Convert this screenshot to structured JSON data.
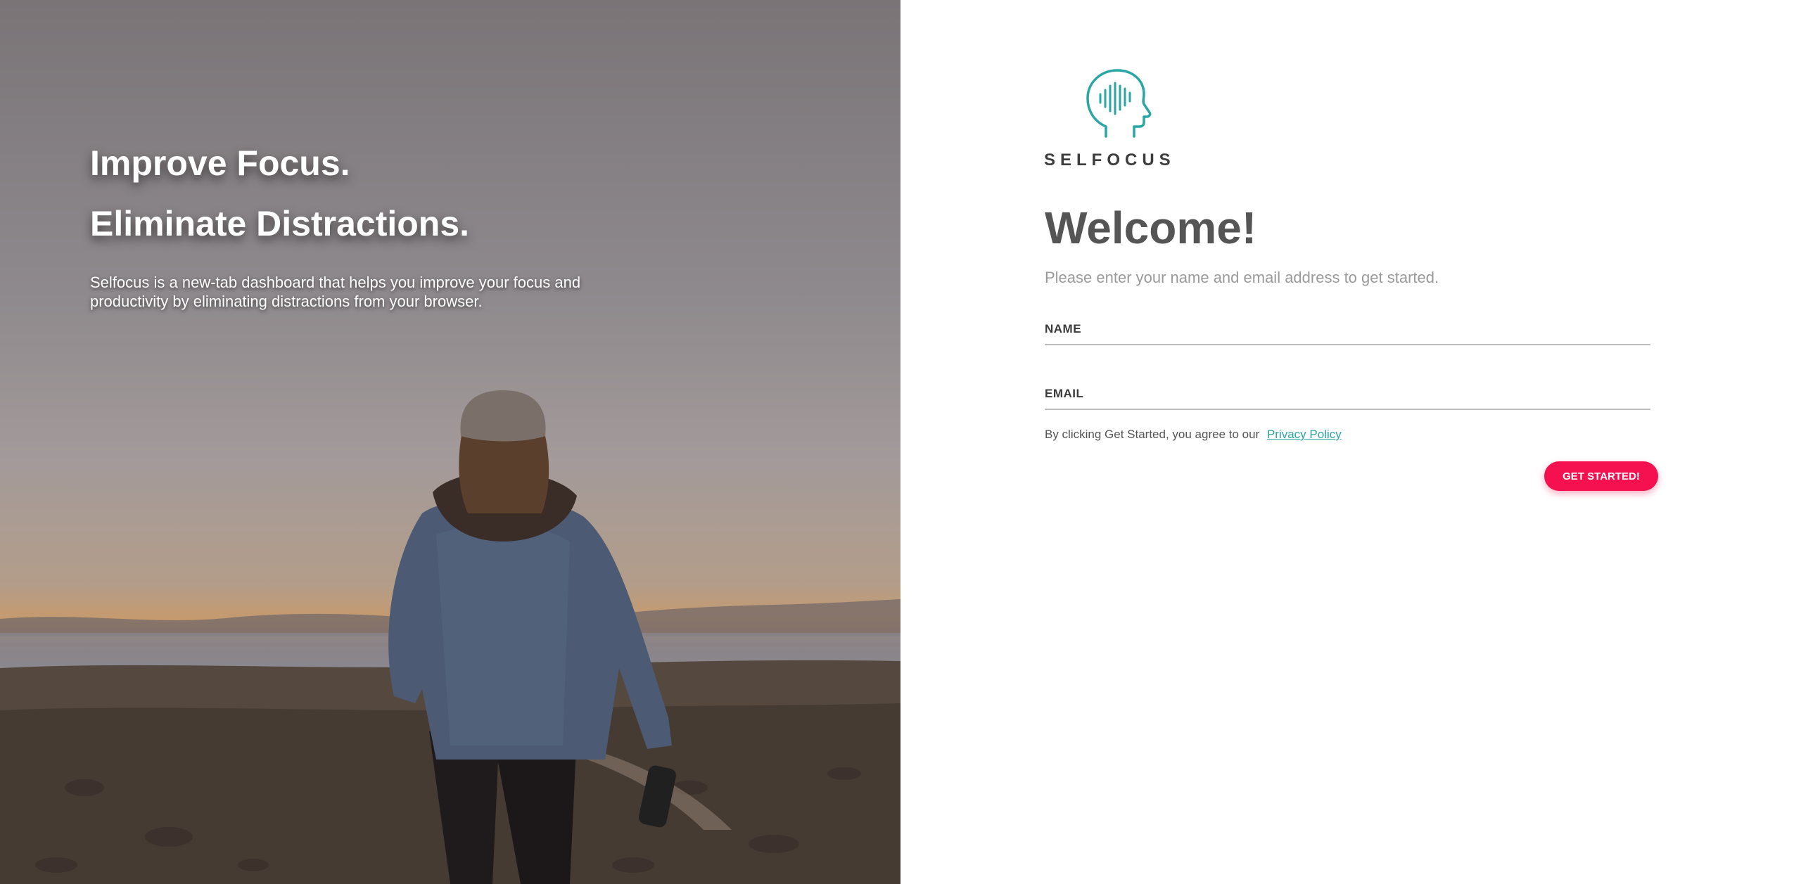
{
  "hero": {
    "heading_1": "Improve Focus.",
    "heading_2": "Eliminate Distractions.",
    "description": "Selfocus is a new-tab dashboard that helps you improve your focus and productivity by eliminating distractions from your browser."
  },
  "brand": {
    "name": "SELFOCUS",
    "logo_icon": "head-soundwave-icon",
    "accent_color": "#2aa6a4"
  },
  "form": {
    "title": "Welcome!",
    "subtitle": "Please enter your name and email address to get started.",
    "name_label": "NAME",
    "name_value": "",
    "email_label": "EMAIL",
    "email_value": "",
    "agreement_text": "By clicking Get Started, you agree to our",
    "privacy_link": "Privacy Policy",
    "submit_label": "GET STARTED!",
    "submit_color": "#f5104f"
  }
}
